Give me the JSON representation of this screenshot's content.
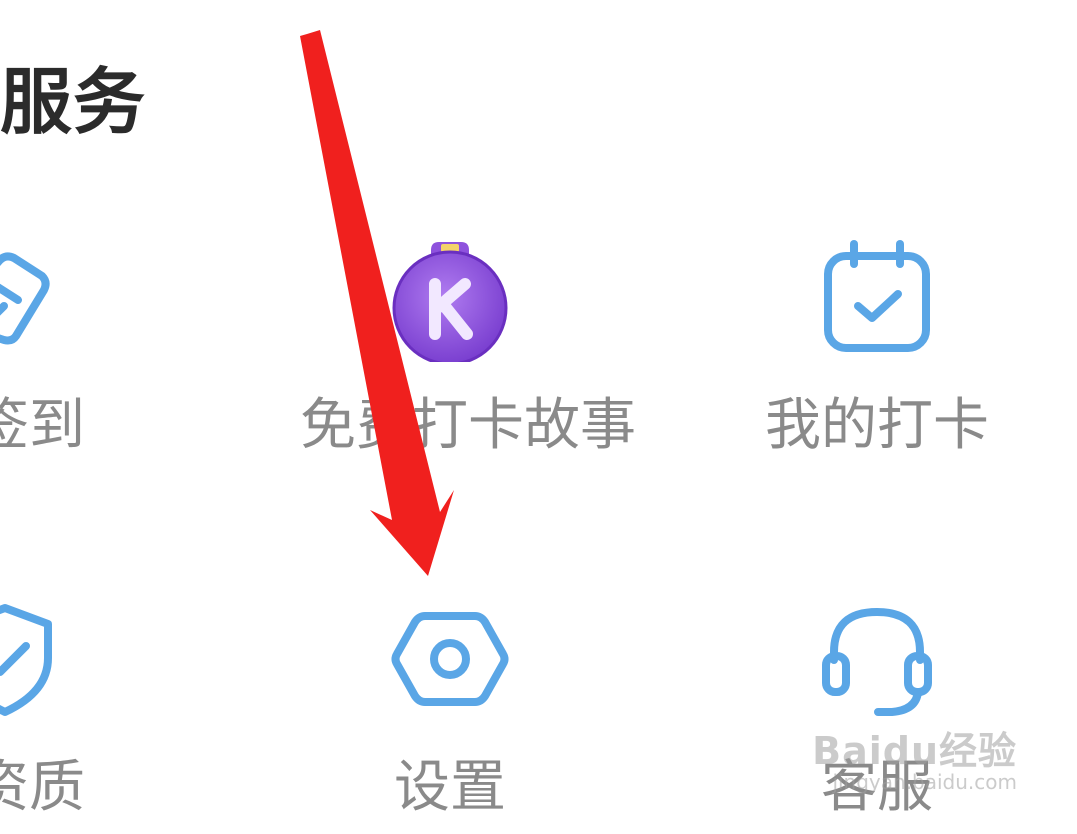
{
  "section": {
    "title": "服务"
  },
  "tiles": [
    {
      "label": "签到",
      "icon": "pen-square-icon"
    },
    {
      "label": "免费打卡故事",
      "icon": "k-medal-icon"
    },
    {
      "label": "我的打卡",
      "icon": "calendar-check-icon"
    },
    {
      "label": "业资质",
      "icon": "shield-check-icon"
    },
    {
      "label": "设置",
      "icon": "gear-hexagon-icon"
    },
    {
      "label": "客服",
      "icon": "headset-icon"
    }
  ],
  "colors": {
    "icon_blue": "#5aa6e6",
    "label_gray": "#8a8a8a",
    "title_dark": "#2b2b2b",
    "arrow_red": "#f0201e",
    "medal_purple": "#9b5de5"
  },
  "watermark": {
    "brand": "Baidu经验",
    "url": "jingyan.baidu.com"
  }
}
